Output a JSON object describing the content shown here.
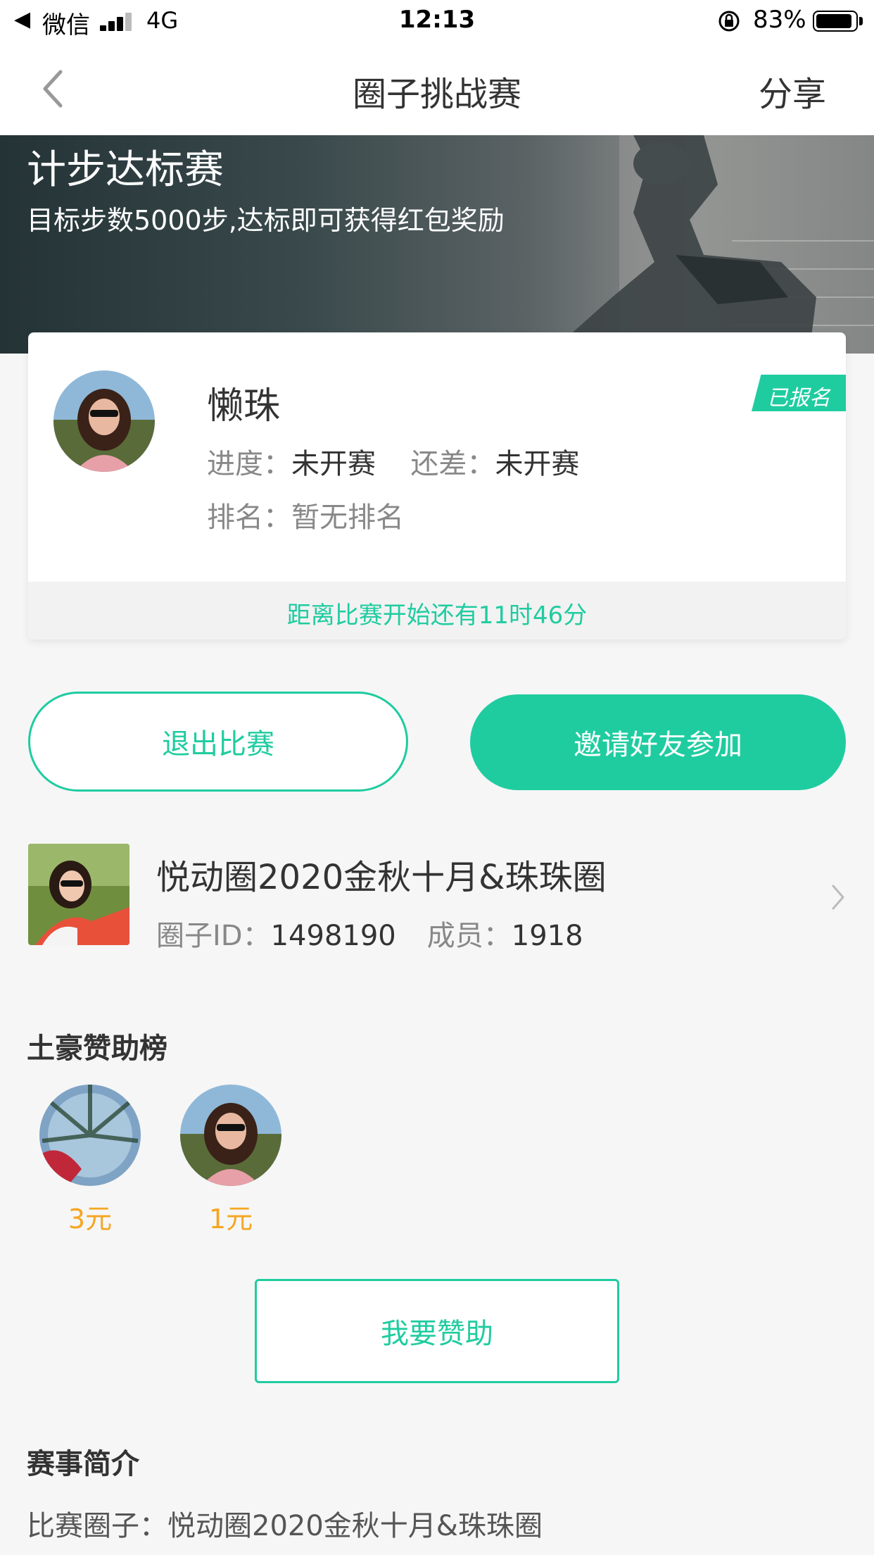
{
  "status_bar": {
    "back_glyph": "◀",
    "app": "微信",
    "network": "4G",
    "time": "12:13",
    "battery": "83%"
  },
  "nav": {
    "title": "圈子挑战赛",
    "share": "分享"
  },
  "hero": {
    "title": "计步达标赛",
    "subtitle": "目标步数5000步,达标即可获得红包奖励"
  },
  "profile": {
    "name": "懒珠",
    "badge": "已报名",
    "progress_label": "进度：",
    "progress_value": "未开赛",
    "remaining_label": "还差：",
    "remaining_value": "未开赛",
    "rank_label": "排名：",
    "rank_value": "暂无排名",
    "countdown": "距离比赛开始还有11时46分"
  },
  "actions": {
    "quit": "退出比赛",
    "invite": "邀请好友参加"
  },
  "circle": {
    "name": "悦动圈2020金秋十月&珠珠圈",
    "id_label": "圈子ID：",
    "id_value": "1498190",
    "members_label": "成员：",
    "members_value": "1918"
  },
  "sponsors": {
    "title": "土豪赞助榜",
    "items": [
      {
        "amount": "3元"
      },
      {
        "amount": "1元"
      }
    ],
    "sponsor_button": "我要赞助"
  },
  "intro": {
    "title": "赛事简介",
    "circle_label": "比赛圈子：",
    "circle_value": "悦动圈2020金秋十月&珠珠圈"
  },
  "colors": {
    "accent": "#1fcca0",
    "amount": "#f5a623"
  }
}
